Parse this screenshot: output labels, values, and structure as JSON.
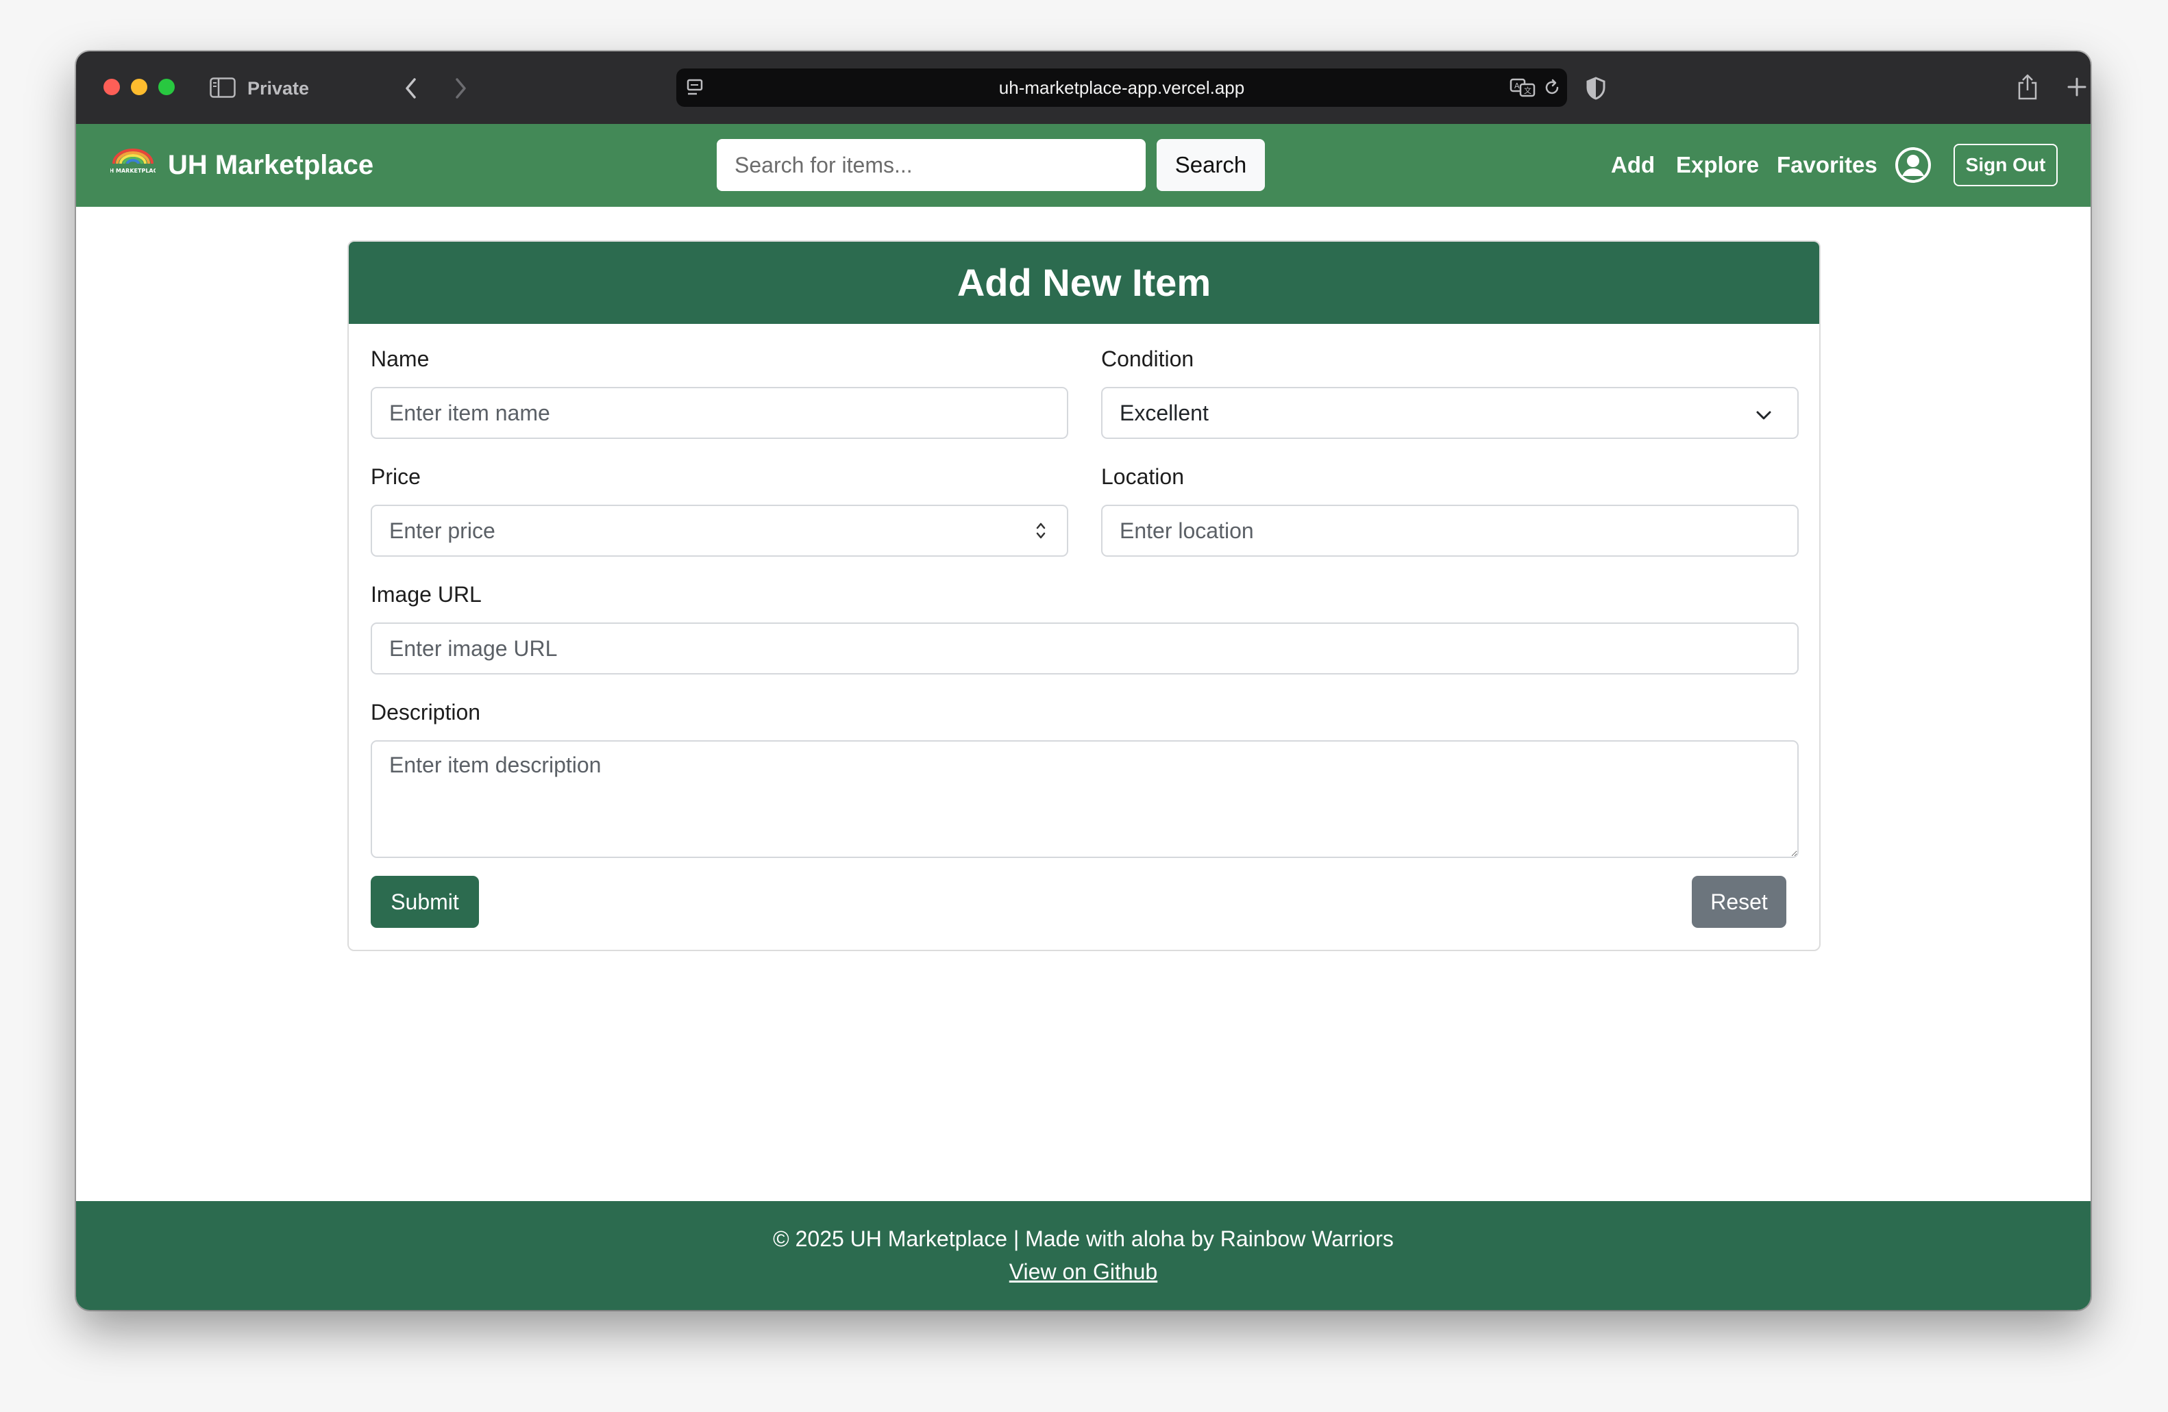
{
  "browser": {
    "private_label": "Private",
    "url": "uh-marketplace-app.vercel.app"
  },
  "navbar": {
    "brand": "UH Marketplace",
    "brand_logo_text": "UH MARKETPLACE",
    "search_placeholder": "Search for items...",
    "search_button": "Search",
    "links": [
      "Add",
      "Explore",
      "Favorites"
    ],
    "sign_out": "Sign Out",
    "color": "#438957"
  },
  "form": {
    "title": "Add New Item",
    "name_label": "Name",
    "name_placeholder": "Enter item name",
    "condition_label": "Condition",
    "condition_value": "Excellent",
    "price_label": "Price",
    "price_placeholder": "Enter price",
    "location_label": "Location",
    "location_placeholder": "Enter location",
    "image_label": "Image URL",
    "image_placeholder": "Enter image URL",
    "description_label": "Description",
    "description_placeholder": "Enter item description",
    "submit": "Submit",
    "reset": "Reset",
    "header_color": "#2c6b4f"
  },
  "footer": {
    "line1": "© 2025 UH Marketplace | Made with aloha by Rainbow Warriors",
    "github_link": "View on Github"
  }
}
